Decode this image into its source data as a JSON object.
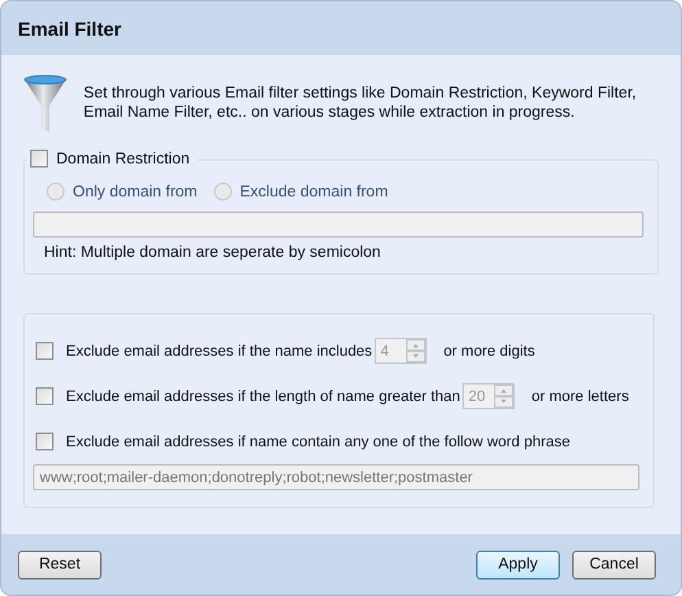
{
  "window": {
    "title": "Email Filter"
  },
  "description": "Set through various Email filter settings like Domain Restriction, Keyword Filter, Email Name Filter, etc.. on various stages while extraction in progress.",
  "domain_restriction": {
    "label": "Domain Restriction",
    "checked": false,
    "disabled": true,
    "options": [
      {
        "label": "Only domain from",
        "selected": false
      },
      {
        "label": "Exclude domain from",
        "selected": false
      }
    ],
    "hint": "Hint: Multiple domain are seperate by semicolon"
  },
  "rules": [
    {
      "kind": "spinner",
      "checked": false,
      "disabled": true,
      "label": "Exclude email addresses if the name includes",
      "value": "4",
      "suffix": "or more digits"
    },
    {
      "kind": "spinner",
      "checked": false,
      "disabled": true,
      "label": "Exclude email addresses if the length of name greater than",
      "value": "20",
      "suffix": "or more letters"
    },
    {
      "kind": "phrase",
      "checked": false,
      "disabled": true,
      "label": "Exclude email addresses if name contain any one of the follow word phrase",
      "value": "www;root;mailer-daemon;donotreply;robot;newsletter;postmaster"
    }
  ],
  "buttons": [
    {
      "label": "Reset",
      "default": false
    },
    {
      "label": "Apply",
      "default": true
    },
    {
      "label": "Cancel",
      "default": false
    }
  ]
}
